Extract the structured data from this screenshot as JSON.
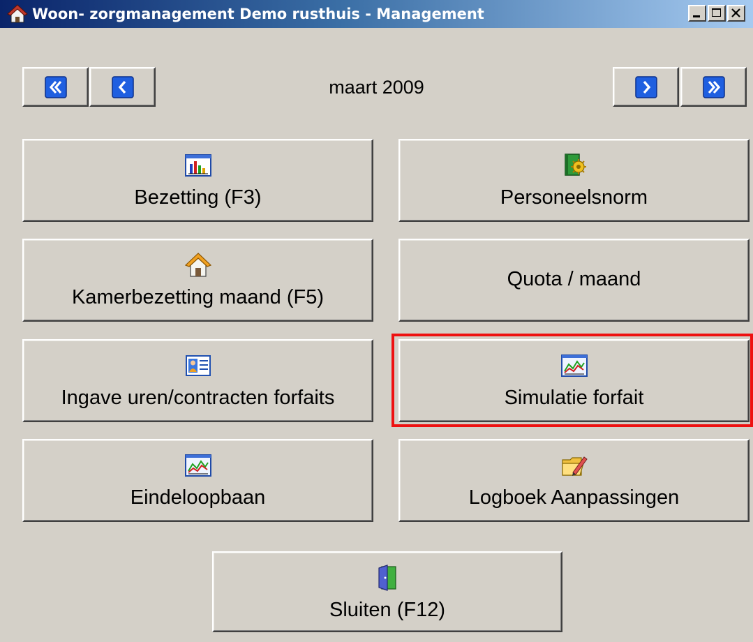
{
  "window": {
    "title": "Woon- zorgmanagement Demo rusthuis - Management",
    "title_icon": "house-app-icon",
    "controls": [
      "minimize-icon",
      "maximize-icon",
      "close-icon"
    ]
  },
  "nav": {
    "month": "maart 2009",
    "first_icon": "double-chevron-left-icon",
    "prev_icon": "chevron-left-icon",
    "next_icon": "chevron-right-icon",
    "last_icon": "double-chevron-right-icon"
  },
  "buttons": {
    "bezetting": {
      "label": "Bezetting (F3)",
      "icon": "bar-chart-icon"
    },
    "personeelsnorm": {
      "label": "Personeelsnorm",
      "icon": "book-gear-icon"
    },
    "kamerbezetting": {
      "label": "Kamerbezetting maand (F5)",
      "icon": "house-icon"
    },
    "quota": {
      "label": "Quota / maand"
    },
    "ingave": {
      "label": "Ingave uren/contracten forfaits",
      "icon": "contact-card-icon"
    },
    "simulatie": {
      "label": "Simulatie forfait",
      "icon": "line-chart-icon"
    },
    "eindeloopbaan": {
      "label": "Eindeloopbaan",
      "icon": "line-chart-icon"
    },
    "logboek": {
      "label": "Logboek Aanpassingen",
      "icon": "folder-pencil-icon"
    },
    "sluiten": {
      "label": "Sluiten (F12)",
      "icon": "door-exit-icon"
    }
  },
  "colors": {
    "face": "#d4d0c8",
    "nav_blue": "#1f5fe0",
    "highlight": "#ee1111"
  }
}
